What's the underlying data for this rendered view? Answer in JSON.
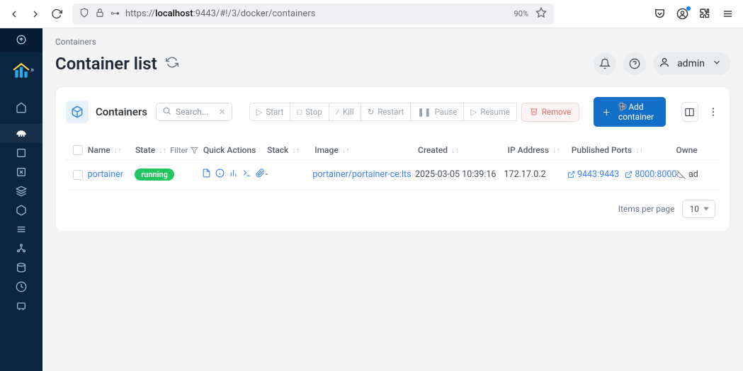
{
  "browser": {
    "url_prefix": "https://",
    "url_host": "localhost",
    "url_rest": ":9443/#!/3/docker/containers",
    "zoom": "90%"
  },
  "breadcrumb": "Containers",
  "page_title": "Container list",
  "user": {
    "name": "admin"
  },
  "card": {
    "title": "Containers",
    "search_placeholder": "Search..."
  },
  "buttons": {
    "start": "Start",
    "stop": "Stop",
    "kill": "Kill",
    "restart": "Restart",
    "pause": "Pause",
    "resume": "Resume",
    "remove": "Remove",
    "add": "Add container"
  },
  "table": {
    "headers": {
      "name": "Name",
      "state": "State",
      "filter": "Filter",
      "quick_actions": "Quick Actions",
      "stack": "Stack",
      "image": "Image",
      "created": "Created",
      "ip": "IP Address",
      "ports": "Published Ports",
      "owner": "Owne"
    },
    "rows": [
      {
        "name": "portainer",
        "state": "running",
        "stack": "-",
        "image": "portainer/portainer-ce:lts",
        "created": "2025-03-05 10:39:16",
        "ip": "172.17.0.2",
        "ports": [
          "9443:9443",
          "8000:8000"
        ],
        "owner": "ad"
      }
    ],
    "footer": {
      "label": "Items per page",
      "per_page": "10"
    }
  }
}
